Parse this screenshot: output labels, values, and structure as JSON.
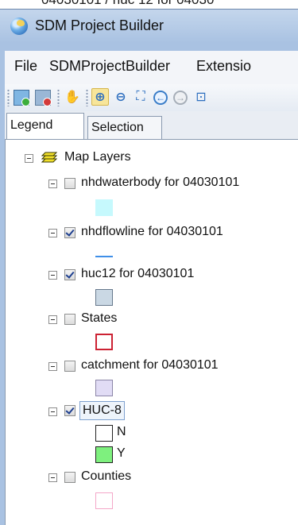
{
  "window": {
    "title": "SDM Project Builder",
    "top_cut_text": "04030101 / huc 12 for 04030"
  },
  "menu": {
    "items": [
      "File",
      "SDMProjectBuilder",
      "Extensio"
    ]
  },
  "toolbar": {
    "buttons": [
      "add-layer",
      "remove-layer",
      "pan",
      "zoom-in",
      "zoom-out",
      "zoom-extent",
      "back",
      "forward",
      "zoom-layer"
    ]
  },
  "tabs": {
    "legend": "Legend",
    "selection": "Selection"
  },
  "legend": {
    "group_label": "Map Layers",
    "layers": [
      {
        "label": "nhdwaterbody for 04030101",
        "checked": false,
        "symbol": "fill",
        "color": "#c6f9fd"
      },
      {
        "label": "nhdflowline for 04030101",
        "checked": true,
        "symbol": "line",
        "color": "#3f8fe8"
      },
      {
        "label": "huc12 for 04030101",
        "checked": true,
        "symbol": "fill",
        "color": "#cad8e4"
      },
      {
        "label": "States",
        "checked": false,
        "symbol": "outline",
        "color": "#cc2233"
      },
      {
        "label": "catchment for 04030101",
        "checked": false,
        "symbol": "fill",
        "color": "#e1dcf5"
      },
      {
        "label": "HUC-8",
        "checked": true,
        "symbol": "categories",
        "categories": [
          {
            "label": "N",
            "color": "#ffffff"
          },
          {
            "label": "Y",
            "color": "#7ef07e"
          }
        ]
      },
      {
        "label": "Counties",
        "checked": false,
        "symbol": "outline",
        "color": "#f4a7c8"
      }
    ]
  },
  "colors": {
    "titlebar": "#a9c2e2",
    "highlight": "#f7e59a"
  }
}
